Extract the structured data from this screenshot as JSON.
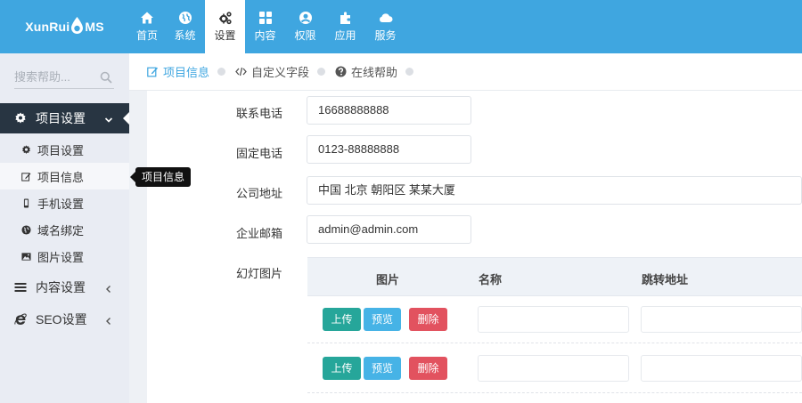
{
  "app": {
    "logo_prefix": "XunRui",
    "logo_suffix": "MS"
  },
  "nav": [
    {
      "label": "首页",
      "icon": "home-icon"
    },
    {
      "label": "系统",
      "icon": "globe-icon"
    },
    {
      "label": "设置",
      "icon": "cogs-icon",
      "active": true
    },
    {
      "label": "内容",
      "icon": "grid-icon"
    },
    {
      "label": "权限",
      "icon": "user-circle-icon"
    },
    {
      "label": "应用",
      "icon": "puzzle-icon"
    },
    {
      "label": "服务",
      "icon": "cloud-icon"
    }
  ],
  "sidebar": {
    "search_placeholder": "搜索帮助...",
    "groups": [
      {
        "label": "项目设置",
        "icon": "gear-icon",
        "expanded": true
      },
      {
        "label": "内容设置",
        "icon": "bars-icon"
      },
      {
        "label": "SEO设置",
        "icon": "ie-icon"
      }
    ],
    "items": [
      {
        "label": "项目设置",
        "icon": "gear-icon"
      },
      {
        "label": "项目信息",
        "icon": "edit-icon",
        "active": true
      },
      {
        "label": "手机设置",
        "icon": "mobile-icon"
      },
      {
        "label": "域名绑定",
        "icon": "globe-icon"
      },
      {
        "label": "图片设置",
        "icon": "picture-icon"
      }
    ],
    "tooltip": "项目信息"
  },
  "tabs": [
    {
      "label": "项目信息",
      "icon": "edit-icon",
      "active": true
    },
    {
      "label": "自定义字段",
      "icon": "code-icon"
    },
    {
      "label": "在线帮助",
      "icon": "question-icon"
    }
  ],
  "form": {
    "phone_label": "联系电话",
    "phone_value": "16688888888",
    "tel_label": "固定电话",
    "tel_value": "0123-88888888",
    "address_label": "公司地址",
    "address_value": "中国 北京 朝阳区 某某大厦",
    "email_label": "企业邮箱",
    "email_value": "admin@admin.com",
    "slides_label": "幻灯图片"
  },
  "slides_table": {
    "headers": [
      "图片",
      "名称",
      "跳转地址"
    ],
    "upload_label": "上传",
    "preview_label": "预览",
    "delete_label": "删除"
  },
  "colors": {
    "header": "#3fa6e0",
    "sidebar": "#e9ecf3",
    "sidebar_active": "#283542",
    "upload": "#26a69a",
    "preview": "#46b3e6",
    "delete": "#e2525f"
  }
}
